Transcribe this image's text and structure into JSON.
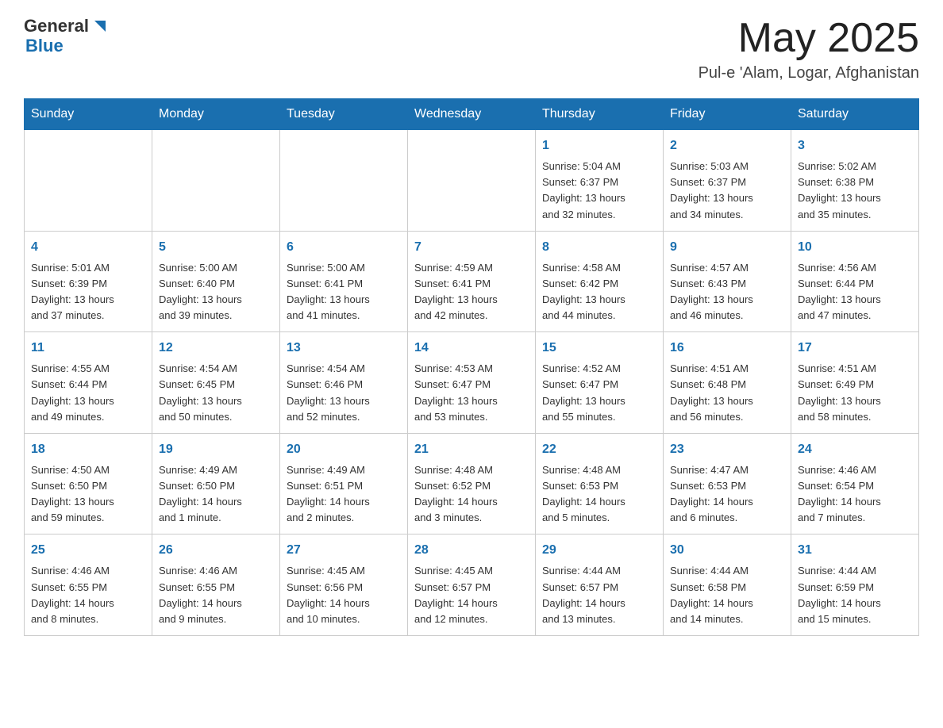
{
  "header": {
    "logo_general": "General",
    "logo_blue": "Blue",
    "month_year": "May 2025",
    "location": "Pul-e 'Alam, Logar, Afghanistan"
  },
  "days_of_week": [
    "Sunday",
    "Monday",
    "Tuesday",
    "Wednesday",
    "Thursday",
    "Friday",
    "Saturday"
  ],
  "weeks": [
    [
      {
        "day": "",
        "info": ""
      },
      {
        "day": "",
        "info": ""
      },
      {
        "day": "",
        "info": ""
      },
      {
        "day": "",
        "info": ""
      },
      {
        "day": "1",
        "info": "Sunrise: 5:04 AM\nSunset: 6:37 PM\nDaylight: 13 hours\nand 32 minutes."
      },
      {
        "day": "2",
        "info": "Sunrise: 5:03 AM\nSunset: 6:37 PM\nDaylight: 13 hours\nand 34 minutes."
      },
      {
        "day": "3",
        "info": "Sunrise: 5:02 AM\nSunset: 6:38 PM\nDaylight: 13 hours\nand 35 minutes."
      }
    ],
    [
      {
        "day": "4",
        "info": "Sunrise: 5:01 AM\nSunset: 6:39 PM\nDaylight: 13 hours\nand 37 minutes."
      },
      {
        "day": "5",
        "info": "Sunrise: 5:00 AM\nSunset: 6:40 PM\nDaylight: 13 hours\nand 39 minutes."
      },
      {
        "day": "6",
        "info": "Sunrise: 5:00 AM\nSunset: 6:41 PM\nDaylight: 13 hours\nand 41 minutes."
      },
      {
        "day": "7",
        "info": "Sunrise: 4:59 AM\nSunset: 6:41 PM\nDaylight: 13 hours\nand 42 minutes."
      },
      {
        "day": "8",
        "info": "Sunrise: 4:58 AM\nSunset: 6:42 PM\nDaylight: 13 hours\nand 44 minutes."
      },
      {
        "day": "9",
        "info": "Sunrise: 4:57 AM\nSunset: 6:43 PM\nDaylight: 13 hours\nand 46 minutes."
      },
      {
        "day": "10",
        "info": "Sunrise: 4:56 AM\nSunset: 6:44 PM\nDaylight: 13 hours\nand 47 minutes."
      }
    ],
    [
      {
        "day": "11",
        "info": "Sunrise: 4:55 AM\nSunset: 6:44 PM\nDaylight: 13 hours\nand 49 minutes."
      },
      {
        "day": "12",
        "info": "Sunrise: 4:54 AM\nSunset: 6:45 PM\nDaylight: 13 hours\nand 50 minutes."
      },
      {
        "day": "13",
        "info": "Sunrise: 4:54 AM\nSunset: 6:46 PM\nDaylight: 13 hours\nand 52 minutes."
      },
      {
        "day": "14",
        "info": "Sunrise: 4:53 AM\nSunset: 6:47 PM\nDaylight: 13 hours\nand 53 minutes."
      },
      {
        "day": "15",
        "info": "Sunrise: 4:52 AM\nSunset: 6:47 PM\nDaylight: 13 hours\nand 55 minutes."
      },
      {
        "day": "16",
        "info": "Sunrise: 4:51 AM\nSunset: 6:48 PM\nDaylight: 13 hours\nand 56 minutes."
      },
      {
        "day": "17",
        "info": "Sunrise: 4:51 AM\nSunset: 6:49 PM\nDaylight: 13 hours\nand 58 minutes."
      }
    ],
    [
      {
        "day": "18",
        "info": "Sunrise: 4:50 AM\nSunset: 6:50 PM\nDaylight: 13 hours\nand 59 minutes."
      },
      {
        "day": "19",
        "info": "Sunrise: 4:49 AM\nSunset: 6:50 PM\nDaylight: 14 hours\nand 1 minute."
      },
      {
        "day": "20",
        "info": "Sunrise: 4:49 AM\nSunset: 6:51 PM\nDaylight: 14 hours\nand 2 minutes."
      },
      {
        "day": "21",
        "info": "Sunrise: 4:48 AM\nSunset: 6:52 PM\nDaylight: 14 hours\nand 3 minutes."
      },
      {
        "day": "22",
        "info": "Sunrise: 4:48 AM\nSunset: 6:53 PM\nDaylight: 14 hours\nand 5 minutes."
      },
      {
        "day": "23",
        "info": "Sunrise: 4:47 AM\nSunset: 6:53 PM\nDaylight: 14 hours\nand 6 minutes."
      },
      {
        "day": "24",
        "info": "Sunrise: 4:46 AM\nSunset: 6:54 PM\nDaylight: 14 hours\nand 7 minutes."
      }
    ],
    [
      {
        "day": "25",
        "info": "Sunrise: 4:46 AM\nSunset: 6:55 PM\nDaylight: 14 hours\nand 8 minutes."
      },
      {
        "day": "26",
        "info": "Sunrise: 4:46 AM\nSunset: 6:55 PM\nDaylight: 14 hours\nand 9 minutes."
      },
      {
        "day": "27",
        "info": "Sunrise: 4:45 AM\nSunset: 6:56 PM\nDaylight: 14 hours\nand 10 minutes."
      },
      {
        "day": "28",
        "info": "Sunrise: 4:45 AM\nSunset: 6:57 PM\nDaylight: 14 hours\nand 12 minutes."
      },
      {
        "day": "29",
        "info": "Sunrise: 4:44 AM\nSunset: 6:57 PM\nDaylight: 14 hours\nand 13 minutes."
      },
      {
        "day": "30",
        "info": "Sunrise: 4:44 AM\nSunset: 6:58 PM\nDaylight: 14 hours\nand 14 minutes."
      },
      {
        "day": "31",
        "info": "Sunrise: 4:44 AM\nSunset: 6:59 PM\nDaylight: 14 hours\nand 15 minutes."
      }
    ]
  ]
}
